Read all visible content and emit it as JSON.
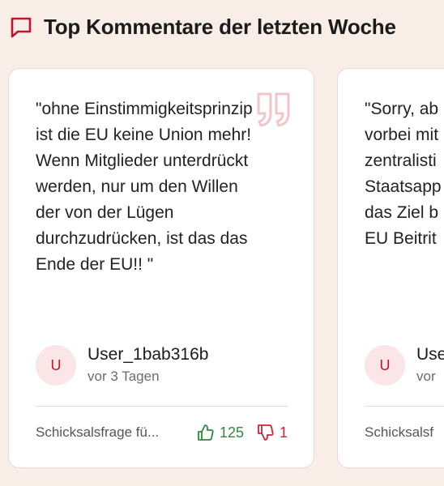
{
  "header": {
    "title": "Top Kommentare der letzten Woche",
    "icon": "comment-icon",
    "accent": "#c8102e"
  },
  "comments": [
    {
      "quote": "\"ohne Einstimmigkeitsprinzip ist die EU keine Union mehr! Wenn Mitglieder unterdrückt werden, nur um den Willen der von der Lügen durchzudrücken, ist das das Ende der EU!! \"",
      "avatar_initial": "U",
      "author": "User_1bab316b",
      "time": "vor 3 Tagen",
      "article": "Schicksalsfrage fü...",
      "likes": "125",
      "dislikes": "1"
    },
    {
      "quote_lines": [
        "\"Sorry, ab",
        "vorbei mit",
        "zentralisti",
        "Staatsapp",
        "das Ziel b",
        "EU Beitrit"
      ],
      "avatar_initial": "U",
      "author": "Use",
      "time": "vor",
      "article": "Schicksalsf"
    }
  ],
  "colors": {
    "background": "#f9ede8",
    "like": "#2e8a3e",
    "dislike": "#d0213a",
    "quote_mark": "#f1c6cb"
  }
}
